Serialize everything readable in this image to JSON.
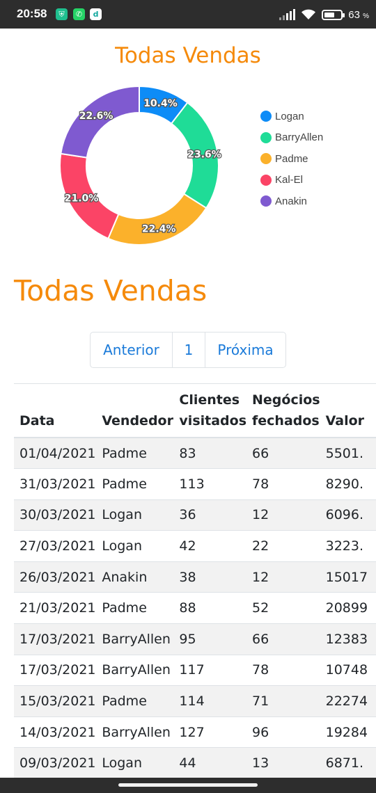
{
  "status_bar": {
    "time": "20:58",
    "battery": "63",
    "battery_unit": "%",
    "battery_level": 0.63
  },
  "chart_title": "Todas Vendas",
  "chart_data": {
    "type": "pie",
    "variant": "doughnut",
    "title": "Todas Vendas",
    "legend_position": "right",
    "categories": [
      "Logan",
      "BarryAllen",
      "Padme",
      "Kal-El",
      "Anakin"
    ],
    "values": [
      10.4,
      23.6,
      22.4,
      21.0,
      22.6
    ],
    "labels": [
      "10.4%",
      "23.6%",
      "22.4%",
      "21.0%",
      "22.6%"
    ],
    "colors": [
      "#0d8cf7",
      "#1fdc97",
      "#fbb12b",
      "#fb4466",
      "#7f5ad0"
    ]
  },
  "section_title": "Todas Vendas",
  "pagination": {
    "prev": "Anterior",
    "page": "1",
    "next": "Próxima"
  },
  "table": {
    "headers": [
      "Data",
      "Vendedor",
      "Clientes visitados",
      "Negócios fechados",
      "Valor"
    ],
    "header_lines": [
      [
        "Data"
      ],
      [
        "Vendedor"
      ],
      [
        "Clientes",
        "visitados"
      ],
      [
        "Negócios",
        "fechados"
      ],
      [
        "Valor"
      ]
    ],
    "rows": [
      [
        "01/04/2021",
        "Padme",
        "83",
        "66",
        "5501."
      ],
      [
        "31/03/2021",
        "Padme",
        "113",
        "78",
        "8290."
      ],
      [
        "30/03/2021",
        "Logan",
        "36",
        "12",
        "6096."
      ],
      [
        "27/03/2021",
        "Logan",
        "42",
        "22",
        "3223."
      ],
      [
        "26/03/2021",
        "Anakin",
        "38",
        "12",
        "15017"
      ],
      [
        "21/03/2021",
        "Padme",
        "88",
        "52",
        "20899"
      ],
      [
        "17/03/2021",
        "BarryAllen",
        "95",
        "66",
        "12383"
      ],
      [
        "17/03/2021",
        "BarryAllen",
        "117",
        "78",
        "10748"
      ],
      [
        "15/03/2021",
        "Padme",
        "114",
        "71",
        "22274"
      ],
      [
        "14/03/2021",
        "BarryAllen",
        "127",
        "96",
        "19284"
      ],
      [
        "09/03/2021",
        "Logan",
        "44",
        "13",
        "6871."
      ]
    ]
  }
}
